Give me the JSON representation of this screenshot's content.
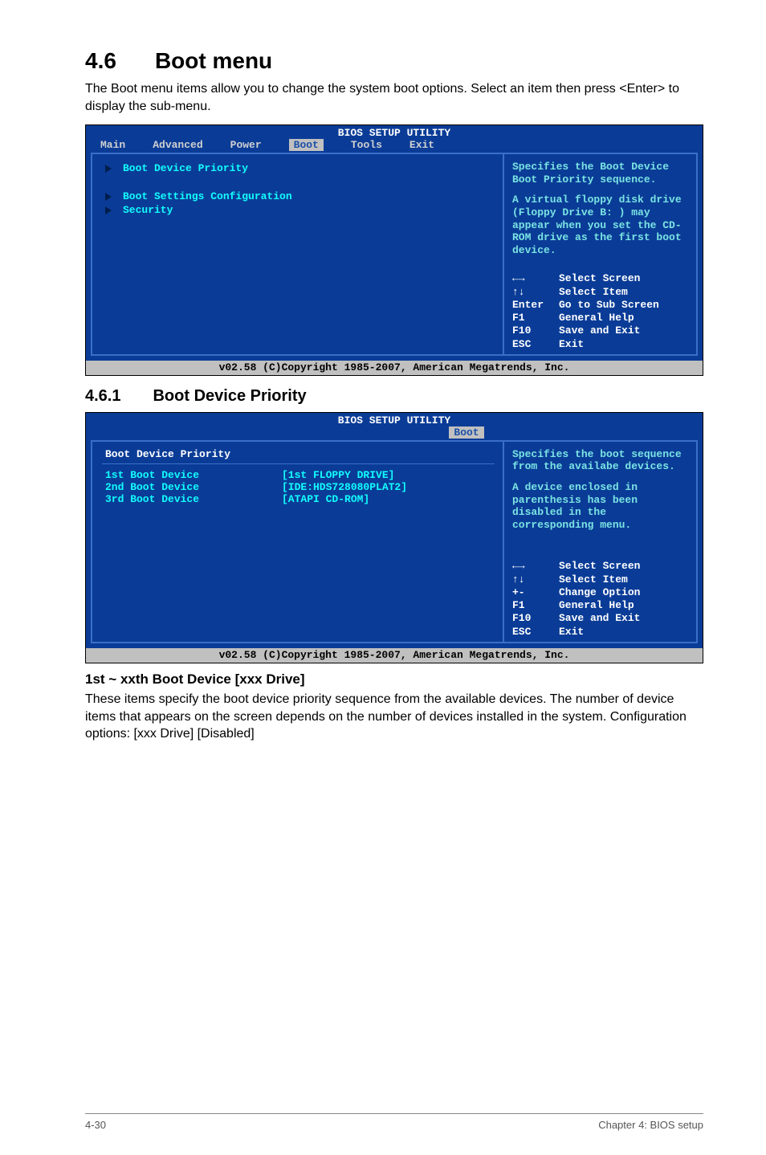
{
  "section": {
    "num": "4.6",
    "title": "Boot menu",
    "intro": "The Boot menu items allow you to change the system boot options. Select an item then press <Enter> to display the sub-menu."
  },
  "subsection": {
    "num": "4.6.1",
    "title": "Boot Device Priority"
  },
  "paragraph": {
    "title": "1st ~ xxth Boot Device [xxx Drive]",
    "body": "These items specify the boot device priority sequence from the available devices. The number of device items that appears on the screen depends on the number of devices installed in the system. Configuration options: [xxx Drive] [Disabled]"
  },
  "bios1": {
    "title": "BIOS SETUP UTILITY",
    "tabs": [
      "Main",
      "Advanced",
      "Power",
      "Boot",
      "Tools",
      "Exit"
    ],
    "selected_tab_index": 3,
    "menu_items": [
      "Boot Device Priority",
      "",
      "Boot Settings Configuration",
      "Security"
    ],
    "help_top": "Specifies the Boot Device Boot Priority sequence.",
    "help_mid": "A virtual floppy disk drive (Floppy Drive B: ) may appear when you set the CD-ROM drive as the first boot device.",
    "key_help": [
      {
        "key": "←→",
        "desc": "Select Screen"
      },
      {
        "key": "↑↓",
        "desc": "Select Item"
      },
      {
        "key": "Enter",
        "desc": "Go to Sub Screen"
      },
      {
        "key": "F1",
        "desc": "General Help"
      },
      {
        "key": "F10",
        "desc": "Save and Exit"
      },
      {
        "key": "ESC",
        "desc": "Exit"
      }
    ],
    "footer": "v02.58 (C)Copyright 1985-2007, American Megatrends, Inc."
  },
  "bios2": {
    "title": "BIOS SETUP UTILITY",
    "selected_tab": "Boot",
    "left_title": "Boot Device Priority",
    "devices": [
      {
        "label": "1st Boot Device",
        "val": "[1st FLOPPY DRIVE]"
      },
      {
        "label": "2nd Boot Device",
        "val": "[IDE:HDS728080PLAT2]"
      },
      {
        "label": "3rd Boot Device",
        "val": "[ATAPI CD-ROM]"
      }
    ],
    "help_top": "Specifies the boot sequence from the availabe devices.",
    "help_mid": "A device enclosed in parenthesis has been disabled in the corresponding menu.",
    "key_help": [
      {
        "key": "←→",
        "desc": "Select Screen"
      },
      {
        "key": "↑↓",
        "desc": "Select Item"
      },
      {
        "key": "+-",
        "desc": "Change Option"
      },
      {
        "key": "F1",
        "desc": "General Help"
      },
      {
        "key": "F10",
        "desc": "Save and Exit"
      },
      {
        "key": "ESC",
        "desc": "Exit"
      }
    ],
    "footer": "v02.58 (C)Copyright 1985-2007, American Megatrends, Inc."
  },
  "footer": {
    "left": "4-30",
    "right": "Chapter 4: BIOS setup"
  }
}
